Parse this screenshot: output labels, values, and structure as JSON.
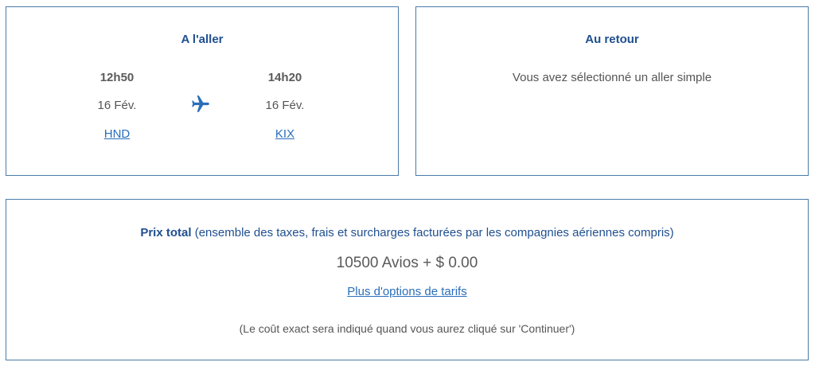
{
  "outbound": {
    "title": "A l'aller",
    "departure": {
      "time": "12h50",
      "date": "16 Fév.",
      "airport": "HND"
    },
    "arrival": {
      "time": "14h20",
      "date": "16 Fév.",
      "airport": "KIX"
    },
    "icon": "airplane-icon"
  },
  "inbound": {
    "title": "Au retour",
    "message": "Vous avez sélectionné un aller simple"
  },
  "price": {
    "label": "Prix total",
    "description": "(ensemble des taxes, frais et surcharges facturées par les compagnies aériennes compris)",
    "amount": "10500 Avios + $ 0.00",
    "more_options_link": "Plus d'options de tarifs",
    "note": "(Le coût exact sera indiqué quand vous aurez cliqué sur 'Continuer')"
  },
  "colors": {
    "accent": "#1f4f8f",
    "link": "#2a6ebb",
    "border": "#4a7ba8"
  }
}
